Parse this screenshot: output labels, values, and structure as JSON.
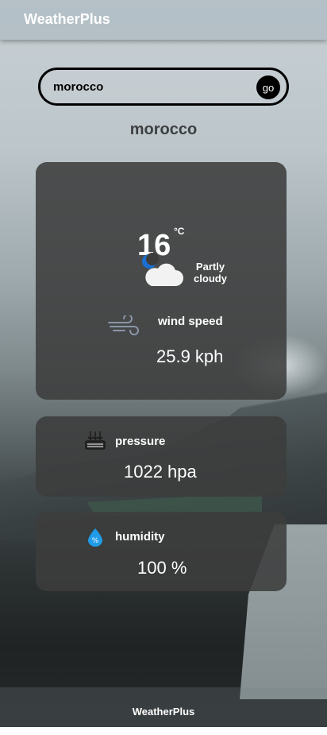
{
  "app": {
    "brand": "WeatherPlus"
  },
  "search": {
    "value": "morocco",
    "go_label": "go"
  },
  "location": {
    "name": "morocco"
  },
  "current": {
    "temperature": "16",
    "unit": "°C",
    "condition": "Partly cloudy",
    "icon": "partly-cloudy-night-icon"
  },
  "wind": {
    "label": "wind speed",
    "value": "25.9 kph",
    "icon": "wind-icon"
  },
  "pressure": {
    "label": "pressure",
    "value": "1022 hpa",
    "icon": "pressure-icon"
  },
  "humidity": {
    "label": "humidity",
    "value": "100 %",
    "icon": "humidity-drop-icon"
  },
  "footer": {
    "brand": "WeatherPlus"
  },
  "colors": {
    "card_bg": "#3c3c3c",
    "accent_drop": "#1f9be8",
    "moon": "#1a6fd1"
  }
}
